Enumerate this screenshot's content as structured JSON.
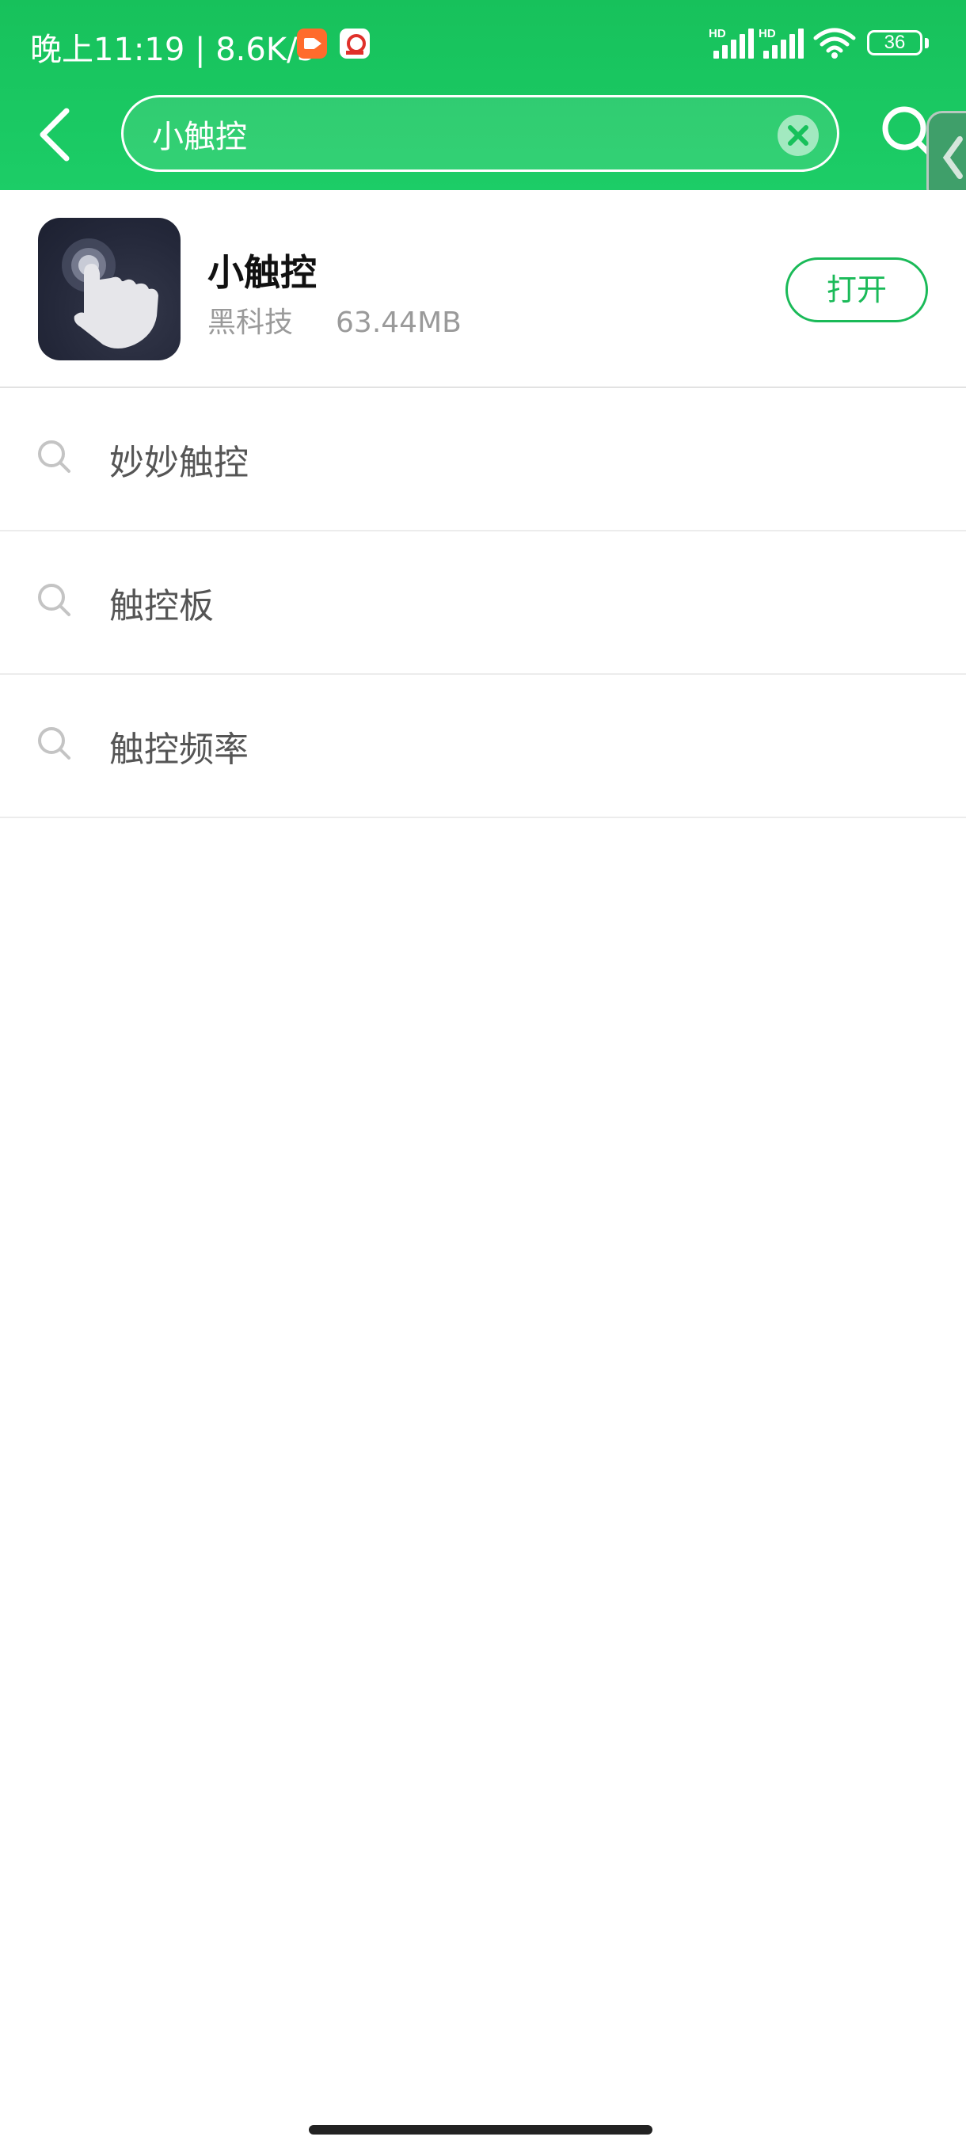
{
  "status_bar": {
    "time": "晚上11:19",
    "separator": "|",
    "net_speed": "8.6K/s",
    "signal_1_label": "HD",
    "signal_2_label": "HD",
    "battery_level": "36"
  },
  "search": {
    "query": "小触控",
    "clear_icon": "clear-circle-x-icon",
    "search_icon": "magnifier-icon",
    "back_icon": "chevron-left-icon"
  },
  "app_result": {
    "name": "小触控",
    "category": "黑科技",
    "size": "63.44MB",
    "action_label": "打开",
    "icon": "touch-hand-icon"
  },
  "suggestions": [
    {
      "text": "妙妙触控"
    },
    {
      "text": "触控板"
    },
    {
      "text": "触控频率"
    }
  ],
  "colors": {
    "header_green": "#17c15b",
    "accent_green": "#1aba58",
    "white": "#ffffff"
  }
}
